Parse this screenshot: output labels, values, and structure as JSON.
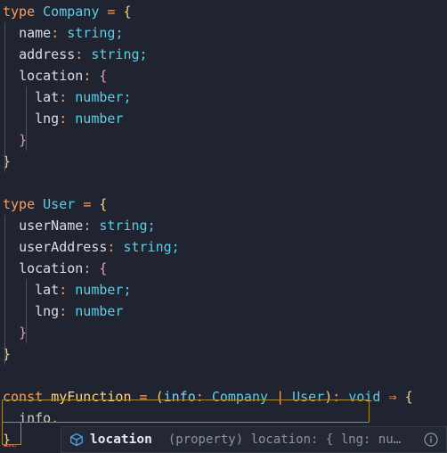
{
  "editor": {
    "background": "#1f2430",
    "lines": [
      {
        "indent": 0,
        "tokens": [
          {
            "t": "type",
            "c": "kw"
          },
          {
            "t": " ",
            "c": "plain"
          },
          {
            "t": "Company",
            "c": "typ"
          },
          {
            "t": " ",
            "c": "plain"
          },
          {
            "t": "=",
            "c": "kw"
          },
          {
            "t": " ",
            "c": "plain"
          },
          {
            "t": "{",
            "c": "punc"
          }
        ]
      },
      {
        "indent": 1,
        "tokens": [
          {
            "t": "name",
            "c": "prop"
          },
          {
            "t": ":",
            "c": "colon"
          },
          {
            "t": " ",
            "c": "plain"
          },
          {
            "t": "string",
            "c": "typ"
          },
          {
            "t": ";",
            "c": "semi"
          }
        ]
      },
      {
        "indent": 1,
        "tokens": [
          {
            "t": "address",
            "c": "prop"
          },
          {
            "t": ":",
            "c": "colon"
          },
          {
            "t": " ",
            "c": "plain"
          },
          {
            "t": "string",
            "c": "typ"
          },
          {
            "t": ";",
            "c": "semi"
          }
        ]
      },
      {
        "indent": 1,
        "tokens": [
          {
            "t": "location",
            "c": "prop"
          },
          {
            "t": ":",
            "c": "colon"
          },
          {
            "t": " ",
            "c": "plain"
          },
          {
            "t": "{",
            "c": "punc2"
          }
        ]
      },
      {
        "indent": 2,
        "tokens": [
          {
            "t": "lat",
            "c": "prop"
          },
          {
            "t": ":",
            "c": "colon"
          },
          {
            "t": " ",
            "c": "plain"
          },
          {
            "t": "number",
            "c": "typ"
          },
          {
            "t": ";",
            "c": "semi"
          }
        ]
      },
      {
        "indent": 2,
        "tokens": [
          {
            "t": "lng",
            "c": "prop"
          },
          {
            "t": ":",
            "c": "colon"
          },
          {
            "t": " ",
            "c": "plain"
          },
          {
            "t": "number",
            "c": "typ"
          }
        ]
      },
      {
        "indent": 1,
        "tokens": [
          {
            "t": "}",
            "c": "punc2"
          }
        ]
      },
      {
        "indent": 0,
        "tokens": [
          {
            "t": "}",
            "c": "punc"
          }
        ]
      },
      {
        "indent": 0,
        "tokens": []
      },
      {
        "indent": 0,
        "tokens": [
          {
            "t": "type",
            "c": "kw"
          },
          {
            "t": " ",
            "c": "plain"
          },
          {
            "t": "User",
            "c": "typ"
          },
          {
            "t": " ",
            "c": "plain"
          },
          {
            "t": "=",
            "c": "kw"
          },
          {
            "t": " ",
            "c": "plain"
          },
          {
            "t": "{",
            "c": "punc"
          }
        ]
      },
      {
        "indent": 1,
        "tokens": [
          {
            "t": "userName",
            "c": "prop"
          },
          {
            "t": ":",
            "c": "colon"
          },
          {
            "t": " ",
            "c": "plain"
          },
          {
            "t": "string",
            "c": "typ"
          },
          {
            "t": ";",
            "c": "semi"
          }
        ]
      },
      {
        "indent": 1,
        "tokens": [
          {
            "t": "userAddress",
            "c": "prop"
          },
          {
            "t": ":",
            "c": "colon"
          },
          {
            "t": " ",
            "c": "plain"
          },
          {
            "t": "string",
            "c": "typ"
          },
          {
            "t": ";",
            "c": "semi"
          }
        ]
      },
      {
        "indent": 1,
        "tokens": [
          {
            "t": "location",
            "c": "prop"
          },
          {
            "t": ":",
            "c": "colon"
          },
          {
            "t": " ",
            "c": "plain"
          },
          {
            "t": "{",
            "c": "punc2"
          }
        ]
      },
      {
        "indent": 2,
        "tokens": [
          {
            "t": "lat",
            "c": "prop"
          },
          {
            "t": ":",
            "c": "colon"
          },
          {
            "t": " ",
            "c": "plain"
          },
          {
            "t": "number",
            "c": "typ"
          },
          {
            "t": ";",
            "c": "semi"
          }
        ]
      },
      {
        "indent": 2,
        "tokens": [
          {
            "t": "lng",
            "c": "prop"
          },
          {
            "t": ":",
            "c": "colon"
          },
          {
            "t": " ",
            "c": "plain"
          },
          {
            "t": "number",
            "c": "typ"
          }
        ]
      },
      {
        "indent": 1,
        "tokens": [
          {
            "t": "}",
            "c": "punc2"
          }
        ]
      },
      {
        "indent": 0,
        "tokens": [
          {
            "t": "}",
            "c": "punc"
          }
        ]
      },
      {
        "indent": 0,
        "tokens": []
      },
      {
        "indent": 0,
        "tokens": [
          {
            "t": "const",
            "c": "kw"
          },
          {
            "t": " ",
            "c": "plain"
          },
          {
            "t": "myFunction",
            "c": "ident"
          },
          {
            "t": " ",
            "c": "plain"
          },
          {
            "t": "=",
            "c": "kw"
          },
          {
            "t": " ",
            "c": "plain"
          },
          {
            "t": "(",
            "c": "punc"
          },
          {
            "t": "info",
            "c": "param"
          },
          {
            "t": ":",
            "c": "colon"
          },
          {
            "t": " ",
            "c": "plain"
          },
          {
            "t": "Company",
            "c": "typ"
          },
          {
            "t": " ",
            "c": "plain"
          },
          {
            "t": "|",
            "c": "kw"
          },
          {
            "t": " ",
            "c": "plain"
          },
          {
            "t": "User",
            "c": "typ"
          },
          {
            "t": ")",
            "c": "punc"
          },
          {
            "t": ":",
            "c": "colon"
          },
          {
            "t": " ",
            "c": "plain"
          },
          {
            "t": "void",
            "c": "typ"
          },
          {
            "t": " ",
            "c": "plain"
          },
          {
            "t": "⇒",
            "c": "kw"
          },
          {
            "t": " ",
            "c": "plain"
          },
          {
            "t": "{",
            "c": "punc"
          }
        ]
      },
      {
        "indent": 1,
        "tokens": [
          {
            "t": "info",
            "c": "plain"
          },
          {
            "t": ".",
            "c": "colon"
          }
        ]
      },
      {
        "indent": 0,
        "tokens": [
          {
            "t": "}",
            "c": "punc"
          }
        ]
      }
    ]
  },
  "suggest": {
    "icon_name": "symbol-property-icon",
    "label": "location",
    "detail_kind": "(property)",
    "detail_signature": "location: { lng: nu…",
    "info_icon_name": "info-icon",
    "label_color": "#e6e8ee",
    "detail_color": "#8b93a3",
    "icon_color": "#4a9fd8",
    "background": "#232834"
  },
  "decorations": {
    "bracket_match_color": "#a6892e",
    "error_squiggle_color": "#e05561",
    "indent_guide_color": "#4a5164"
  }
}
